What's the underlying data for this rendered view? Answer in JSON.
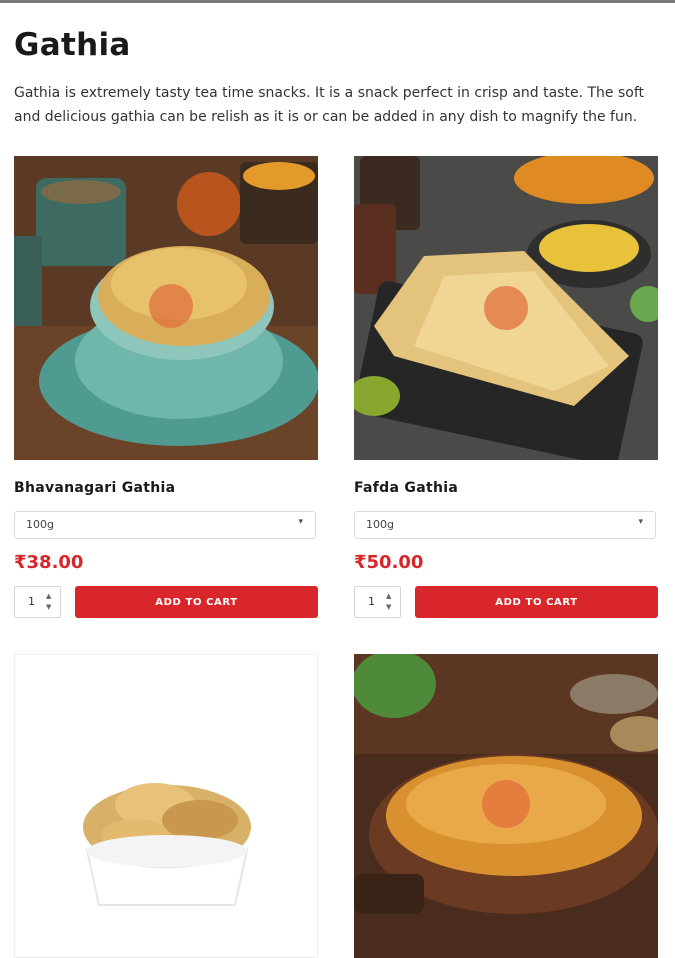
{
  "page": {
    "title": "Gathia",
    "description": "Gathia is extremely tasty tea time snacks. It is a snack perfect in crisp and taste. The soft and delicious gathia can be relish as it is or can be added in any dish to magnify the fun."
  },
  "products": [
    {
      "name": "Bhavanagari Gathia",
      "variant": "100g",
      "price": "₹38.00",
      "qty": "1",
      "cta": "ADD TO CART"
    },
    {
      "name": "Fafda Gathia",
      "variant": "100g",
      "price": "₹50.00",
      "qty": "1",
      "cta": "ADD TO CART"
    },
    {
      "name": "",
      "variant": "",
      "price": "",
      "qty": "",
      "cta": ""
    },
    {
      "name": "",
      "variant": "",
      "price": "",
      "qty": "",
      "cta": ""
    }
  ],
  "colors": {
    "accent": "#d9262b",
    "price": "#d9262b"
  },
  "icons": {
    "dropdown": "chevron-down-icon",
    "stepper": "up-down-arrows-icon"
  }
}
